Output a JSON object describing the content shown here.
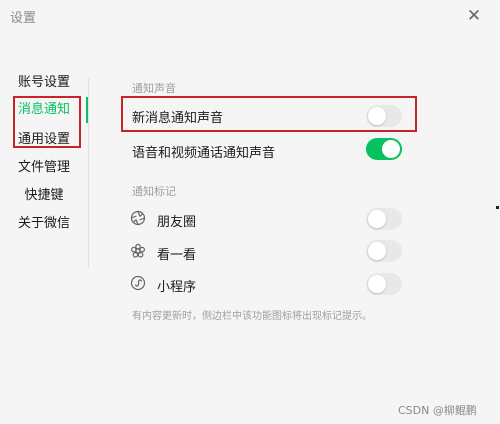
{
  "window": {
    "title": "设置",
    "close_glyph": "✕"
  },
  "sidebar": {
    "items": [
      {
        "label": "账号设置",
        "active": false
      },
      {
        "label": "消息通知",
        "active": true
      },
      {
        "label": "通用设置",
        "active": false
      },
      {
        "label": "文件管理",
        "active": false
      },
      {
        "label": "快捷键",
        "active": false
      },
      {
        "label": "关于微信",
        "active": false
      }
    ]
  },
  "sections": {
    "sound": {
      "title": "通知声音",
      "rows": [
        {
          "label": "新消息通知声音",
          "enabled": false
        },
        {
          "label": "语音和视频通话通知声音",
          "enabled": true
        }
      ]
    },
    "badge": {
      "title": "通知标记",
      "rows": [
        {
          "label": "朋友圈",
          "icon": "moments-aperture-icon",
          "enabled": false
        },
        {
          "label": "看一看",
          "icon": "look-flower-icon",
          "enabled": false
        },
        {
          "label": "小程序",
          "icon": "mini-program-icon",
          "enabled": false
        }
      ],
      "hint": "有内容更新时，侧边栏中该功能图标将出现标记提示。"
    }
  },
  "watermark": "CSDN @柳鲲鹏",
  "colors": {
    "accent": "#07c160",
    "highlight_box": "#c8222a",
    "toggle_off": "#e8e8e8"
  }
}
